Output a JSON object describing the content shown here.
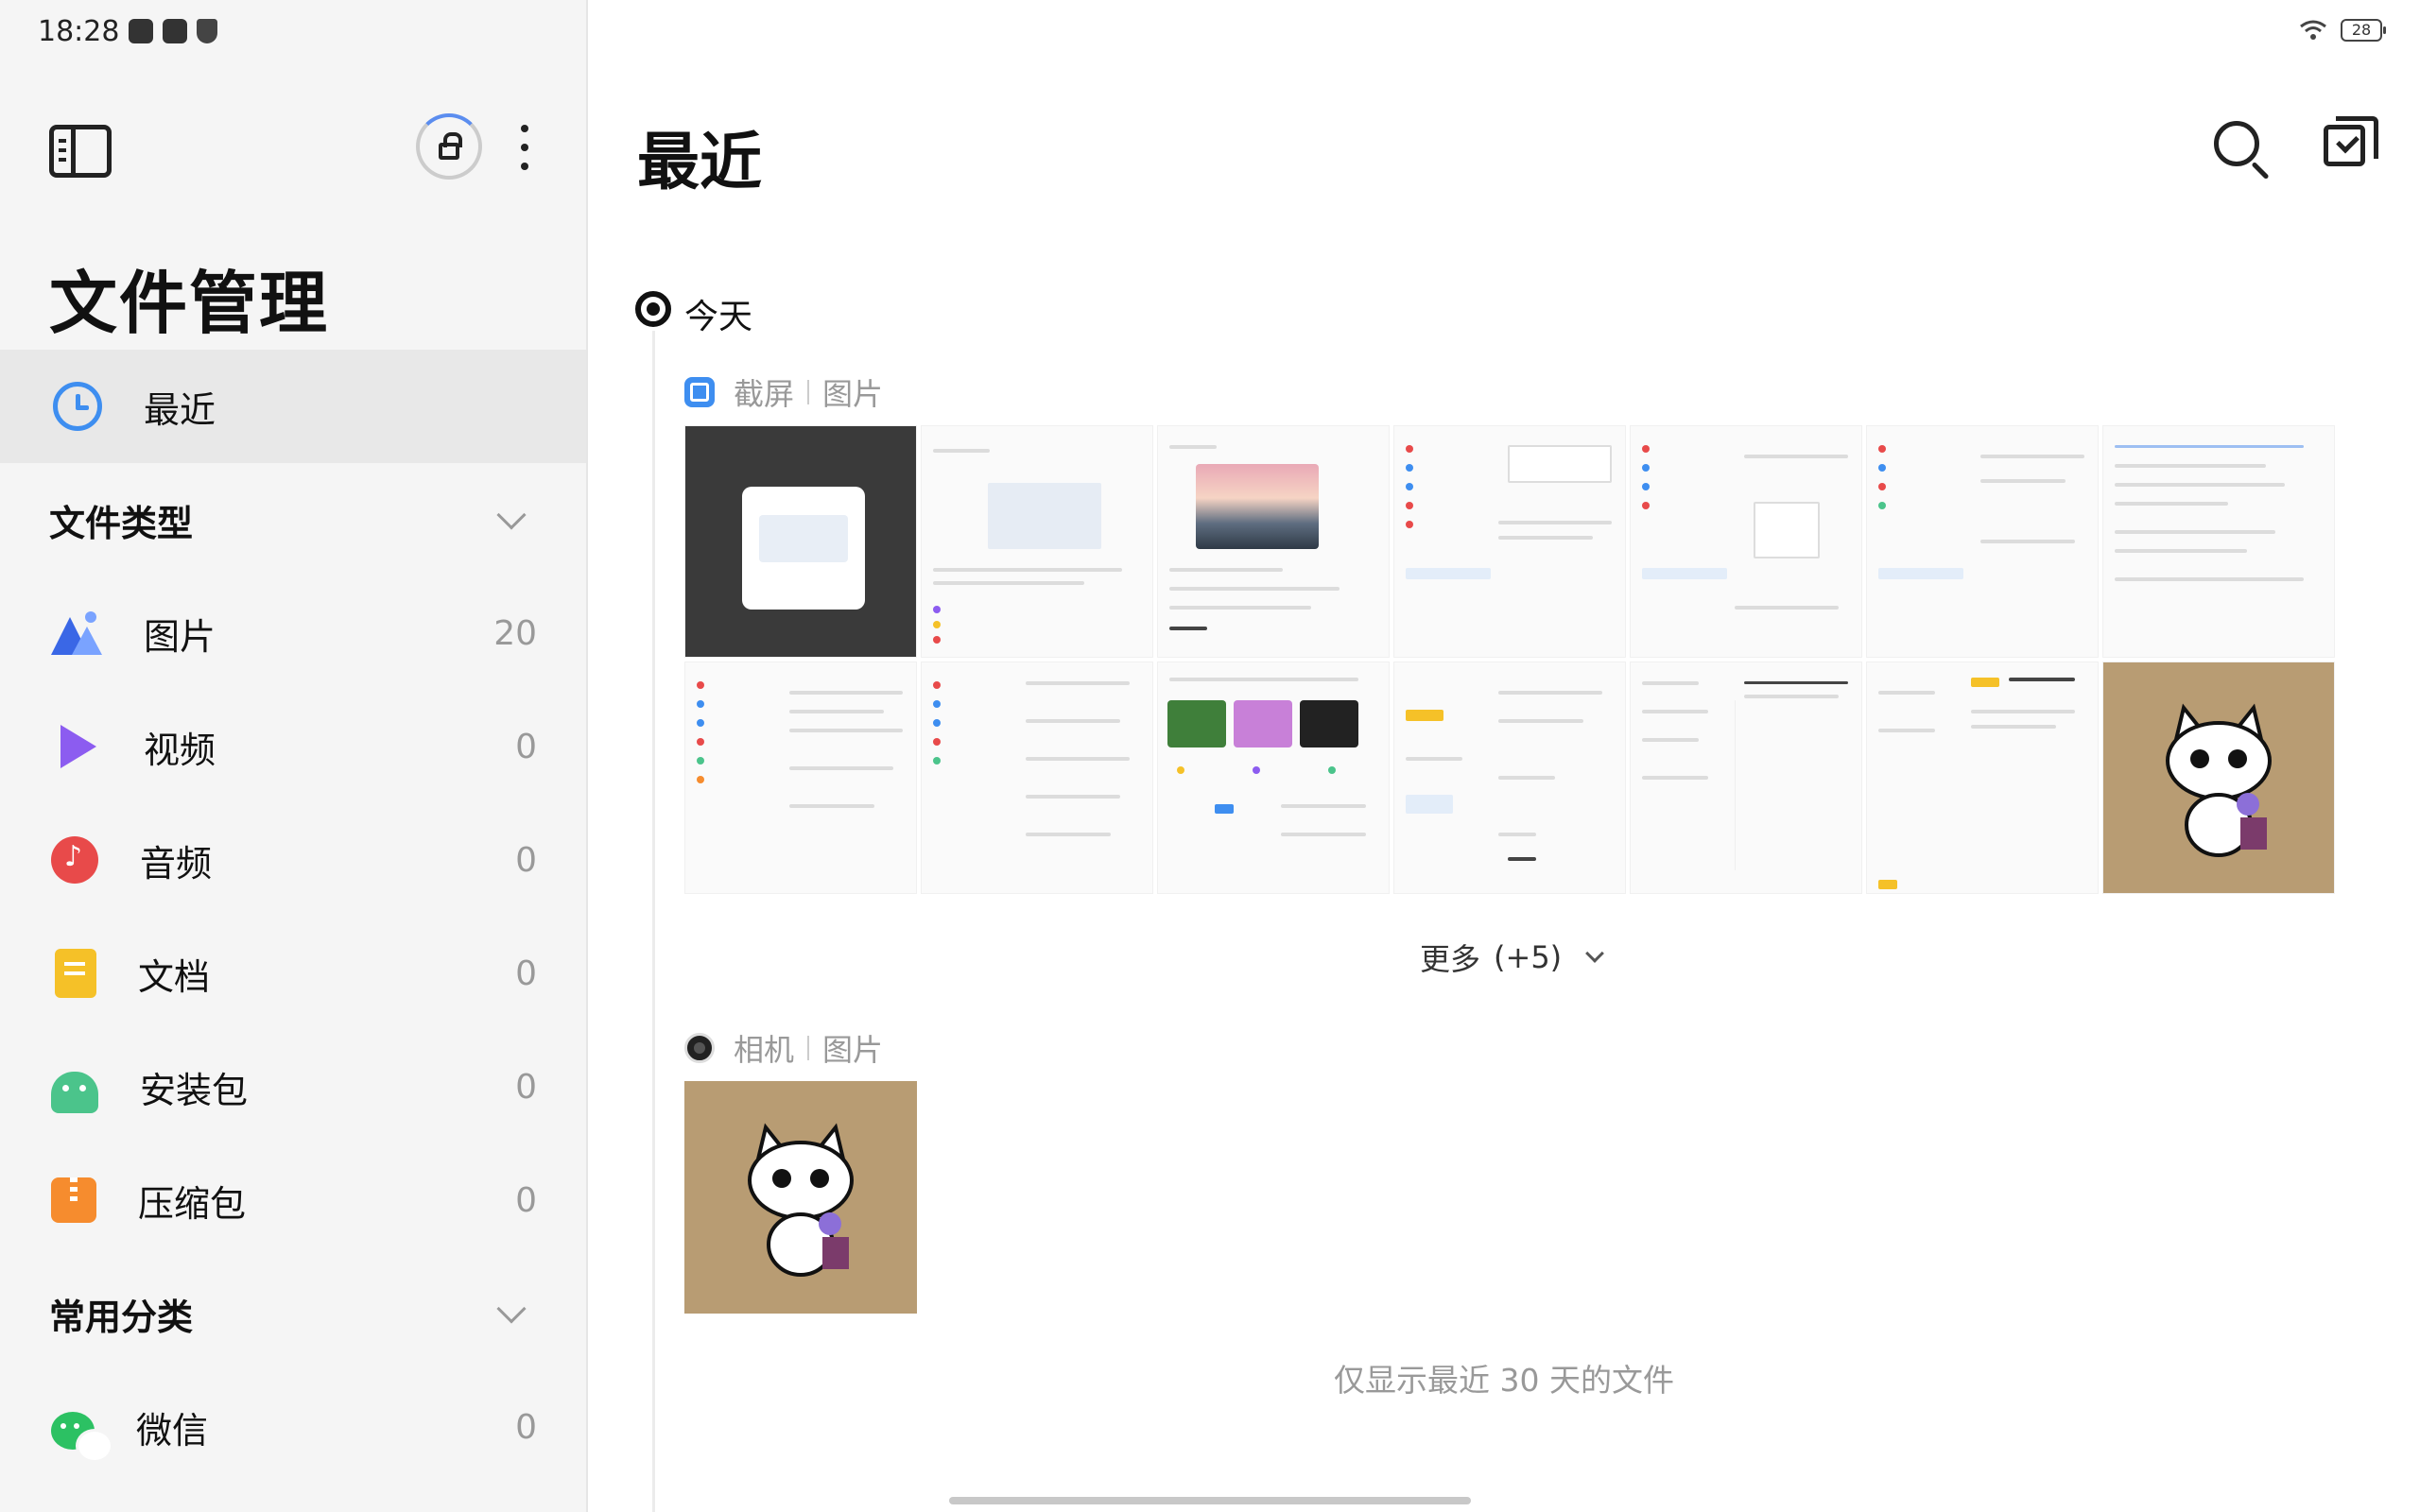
{
  "status_bar": {
    "time": "18:28",
    "battery": "28"
  },
  "sidebar": {
    "app_title": "文件管理",
    "recent_label": "最近",
    "file_types_header": "文件类型",
    "types": [
      {
        "label": "图片",
        "count": "20",
        "icon": "image-icon"
      },
      {
        "label": "视频",
        "count": "0",
        "icon": "video-icon"
      },
      {
        "label": "音频",
        "count": "0",
        "icon": "audio-icon"
      },
      {
        "label": "文档",
        "count": "0",
        "icon": "document-icon"
      },
      {
        "label": "安装包",
        "count": "0",
        "icon": "apk-icon"
      },
      {
        "label": "压缩包",
        "count": "0",
        "icon": "archive-icon"
      }
    ],
    "common_header": "常用分类",
    "common": [
      {
        "label": "微信",
        "count": "0",
        "icon": "wechat-icon"
      }
    ]
  },
  "main": {
    "title": "最近",
    "today_label": "今天",
    "groups": [
      {
        "app": "截屏",
        "kind": "图片"
      },
      {
        "app": "相机",
        "kind": "图片"
      }
    ],
    "more_label": "更多",
    "more_count": "(+5)",
    "footer_note": "仅显示最近  30  天的文件"
  },
  "colors": {
    "accent": "#3e8ef0",
    "selected_bg": "#e8e8e8",
    "muted_text": "#999999"
  }
}
